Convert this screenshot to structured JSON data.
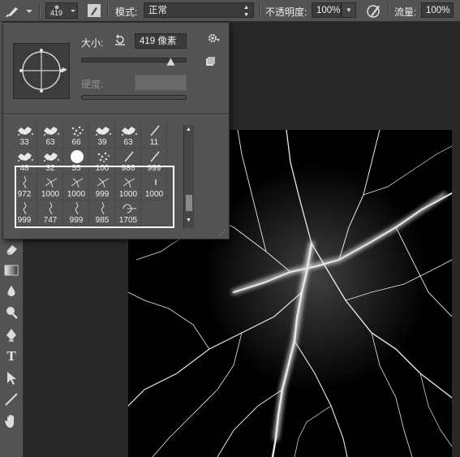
{
  "options_bar": {
    "brush_size": "419",
    "mode_label": "模式:",
    "mode_value": "正常",
    "opacity_label": "不透明度:",
    "opacity_value": "100%",
    "flow_label": "流量:",
    "flow_value": "100%"
  },
  "brush_popup": {
    "size_label": "大小:",
    "size_value": "419 像素",
    "hardness_label": "硬度:",
    "presets": [
      {
        "size": "33"
      },
      {
        "size": "63"
      },
      {
        "size": "66"
      },
      {
        "size": "39"
      },
      {
        "size": "63"
      },
      {
        "size": "11"
      },
      {
        "size": "48"
      },
      {
        "size": "32"
      },
      {
        "size": "55"
      },
      {
        "size": "100"
      },
      {
        "size": "986"
      },
      {
        "size": "999"
      },
      {
        "size": "972"
      },
      {
        "size": "1000"
      },
      {
        "size": "1000"
      },
      {
        "size": "999"
      },
      {
        "size": "1000"
      },
      {
        "size": "1000"
      },
      {
        "size": "999"
      },
      {
        "size": "747"
      },
      {
        "size": "999"
      },
      {
        "size": "985"
      },
      {
        "size": "1705"
      }
    ]
  },
  "tools": [
    "eraser-icon",
    "gradient-icon",
    "blur-icon",
    "dodge-icon",
    "pen-icon",
    "type-icon",
    "path-select-icon",
    "line-icon",
    "hand-icon"
  ]
}
